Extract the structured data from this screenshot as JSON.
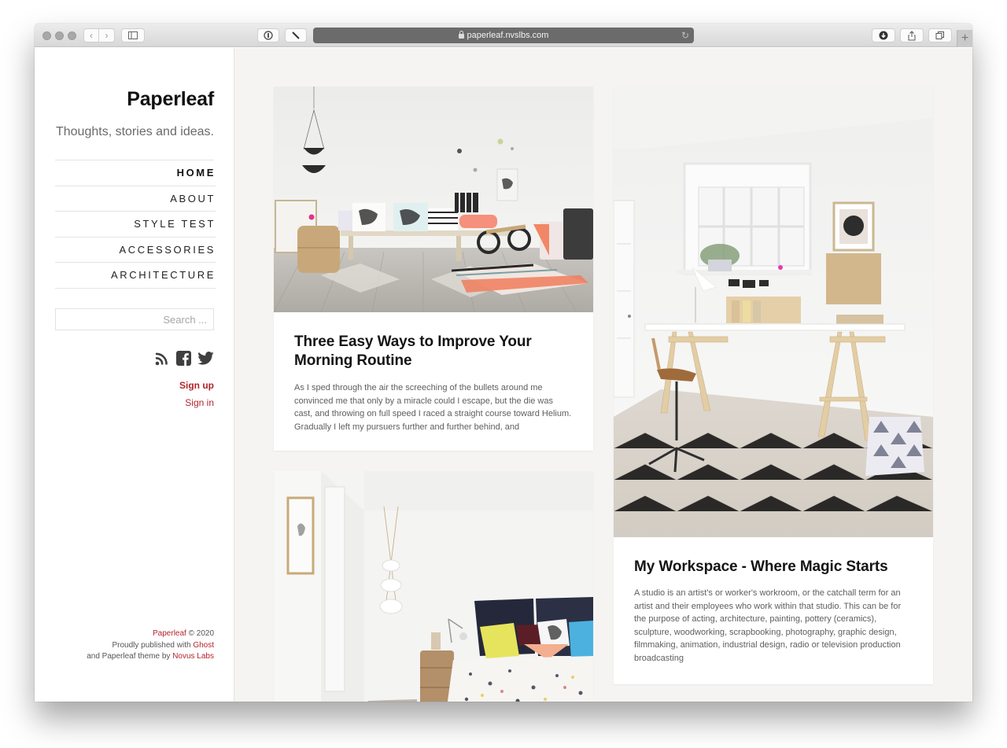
{
  "browser": {
    "url": "paperleaf.nvslbs.com",
    "icons": {
      "sidebar_toggle": "sidebar-icon",
      "password": "password-manager-icon",
      "extension": "pen-icon",
      "reload": "reload-icon",
      "download": "download-icon",
      "share": "share-icon",
      "tabs": "tabs-overview-icon",
      "new_tab": "+"
    }
  },
  "sidebar": {
    "title": "Paperleaf",
    "description": "Thoughts, stories and ideas.",
    "menu": [
      {
        "label": "HOME",
        "active": true
      },
      {
        "label": "ABOUT",
        "active": false
      },
      {
        "label": "STYLE TEST",
        "active": false
      },
      {
        "label": "ACCESSORIES",
        "active": false
      },
      {
        "label": "ARCHITECTURE",
        "active": false
      }
    ],
    "search": {
      "placeholder": "Search ...",
      "value": ""
    },
    "social": [
      "rss-icon",
      "facebook-icon",
      "twitter-icon"
    ],
    "sign_up": "Sign up",
    "sign_in": "Sign in",
    "footer": {
      "brand": "Paperleaf",
      "copyright": " © 2020",
      "published_prefix": "Proudly published with ",
      "ghost": "Ghost",
      "theme_prefix": "and Paperleaf theme by ",
      "novus": "Novus Labs"
    }
  },
  "posts": [
    {
      "title": "Three Easy Ways to Improve Your Morning Routine",
      "excerpt": "As I sped through the air the screeching of the bullets around me convinced me that only by a miracle could I escape, but the die was cast, and throwing on full speed I raced a straight course toward Helium. Gradually I left my pursuers further and further behind, and",
      "image": "living-room-bench-photo"
    },
    {
      "title": "My Workspace - Where Magic Starts",
      "excerpt": "A studio is an artist's or worker's workroom, or the catchall term for an artist and their employees who work within that studio. This can be for the purpose of acting, architecture, painting, pottery (ceramics), sculpture, woodworking, scrapbooking, photography, graphic design, filmmaking, animation, industrial design, radio or television production broadcasting",
      "image": "workspace-desk-photo"
    },
    {
      "title": "",
      "excerpt": "",
      "image": "bedroom-photo"
    }
  ]
}
